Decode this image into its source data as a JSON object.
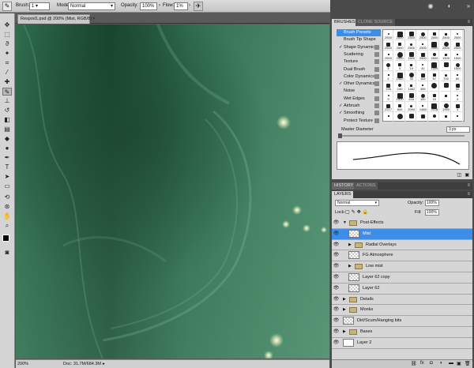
{
  "options_bar": {
    "brush_label": "Brush:",
    "brush_size": "1",
    "mode_label": "Mode:",
    "mode_value": "Normal",
    "opacity_label": "Opacity:",
    "opacity_value": "100%",
    "flow_label": "Flow:",
    "flow_value": "1%"
  },
  "document": {
    "tab_title": "Respod1.psd @ 200% (Mist, RGB/8) ×"
  },
  "status_bar": {
    "zoom": "200%",
    "doc_size": "Doc: 31.7M/684.3M"
  },
  "brushes_panel": {
    "tabs": [
      "BRUSHES",
      "CLONE SOURCE"
    ],
    "menu": [
      {
        "label": "Brush Presets",
        "checked": false,
        "selected": true
      },
      {
        "label": "Brush Tip Shape",
        "checked": false,
        "selected": false
      },
      {
        "label": "Shape Dynamics",
        "checked": true,
        "selected": false
      },
      {
        "label": "Scattering",
        "checked": false,
        "selected": false
      },
      {
        "label": "Texture",
        "checked": false,
        "selected": false
      },
      {
        "label": "Dual Brush",
        "checked": false,
        "selected": false
      },
      {
        "label": "Color Dynamics",
        "checked": false,
        "selected": false
      },
      {
        "label": "Other Dynamics",
        "checked": true,
        "selected": false
      },
      {
        "label": "Noise",
        "checked": false,
        "selected": false
      },
      {
        "label": "Wet Edges",
        "checked": false,
        "selected": false
      },
      {
        "label": "Airbrush",
        "checked": true,
        "selected": false
      },
      {
        "label": "Smoothing",
        "checked": true,
        "selected": false
      },
      {
        "label": "Protect Texture",
        "checked": false,
        "selected": false
      }
    ],
    "grid_rows": [
      [
        "2500",
        "2500",
        "2500",
        "2500",
        "2500",
        "2500",
        "2500"
      ],
      [
        "2500",
        "2500",
        "2500",
        "2500",
        "2500",
        "2500",
        "2500"
      ],
      [
        "2500",
        "2500",
        "1500",
        "2500",
        "2500",
        "1500",
        "1500"
      ],
      [
        "4",
        "5",
        "19",
        "42",
        "1500",
        "",
        "1500"
      ],
      [
        "4",
        "1462",
        "33",
        "154",
        "57",
        "700",
        "60"
      ],
      [
        "196",
        "100",
        "1462",
        "395",
        "",
        "",
        "42"
      ],
      [
        "9",
        "1000",
        "418",
        "100",
        "10",
        "",
        "3"
      ],
      [
        "2217",
        "806",
        "2094",
        "1468",
        "2118",
        "1950",
        "4"
      ],
      [
        "",
        "",
        "",
        "",
        "",
        "",
        ""
      ]
    ],
    "master_diameter_label": "Master Diameter",
    "master_diameter_value": "3 px"
  },
  "history_tabs": [
    "HISTORY",
    "ACTIONS"
  ],
  "layers_panel": {
    "tab": "LAYERS",
    "blend_mode": "Normal",
    "opacity_label": "Opacity:",
    "opacity_value": "100%",
    "lock_label": "Lock:",
    "fill_label": "Fill:",
    "fill_value": "100%",
    "layers": [
      {
        "name": "Post-Effects",
        "kind": "group",
        "indent": 0,
        "expanded": true,
        "selected": false
      },
      {
        "name": "Mist",
        "kind": "layer",
        "indent": 1,
        "expanded": false,
        "selected": true
      },
      {
        "name": "Radial Overlays",
        "kind": "group",
        "indent": 1,
        "expanded": false,
        "selected": false
      },
      {
        "name": "FG Atmosphere",
        "kind": "layer",
        "indent": 1,
        "expanded": false,
        "selected": false
      },
      {
        "name": "Low mist",
        "kind": "group",
        "indent": 1,
        "expanded": false,
        "selected": false
      },
      {
        "name": "Layer 62 copy",
        "kind": "layer",
        "indent": 1,
        "expanded": false,
        "selected": false
      },
      {
        "name": "Layer 62",
        "kind": "layer",
        "indent": 1,
        "expanded": false,
        "selected": false
      },
      {
        "name": "Details",
        "kind": "group",
        "indent": 0,
        "expanded": false,
        "selected": false
      },
      {
        "name": "Monks",
        "kind": "group",
        "indent": 0,
        "expanded": false,
        "selected": false
      },
      {
        "name": "Dirt/Scum/Hanging bits",
        "kind": "layer",
        "indent": 0,
        "expanded": false,
        "selected": false
      },
      {
        "name": "Bases",
        "kind": "group",
        "indent": 0,
        "expanded": false,
        "selected": false
      },
      {
        "name": "Layer 2",
        "kind": "white",
        "indent": 0,
        "expanded": false,
        "selected": false
      }
    ]
  },
  "colors": {
    "canvas_green": "#3c7a5a",
    "selection_blue": "#3d8ee8"
  }
}
